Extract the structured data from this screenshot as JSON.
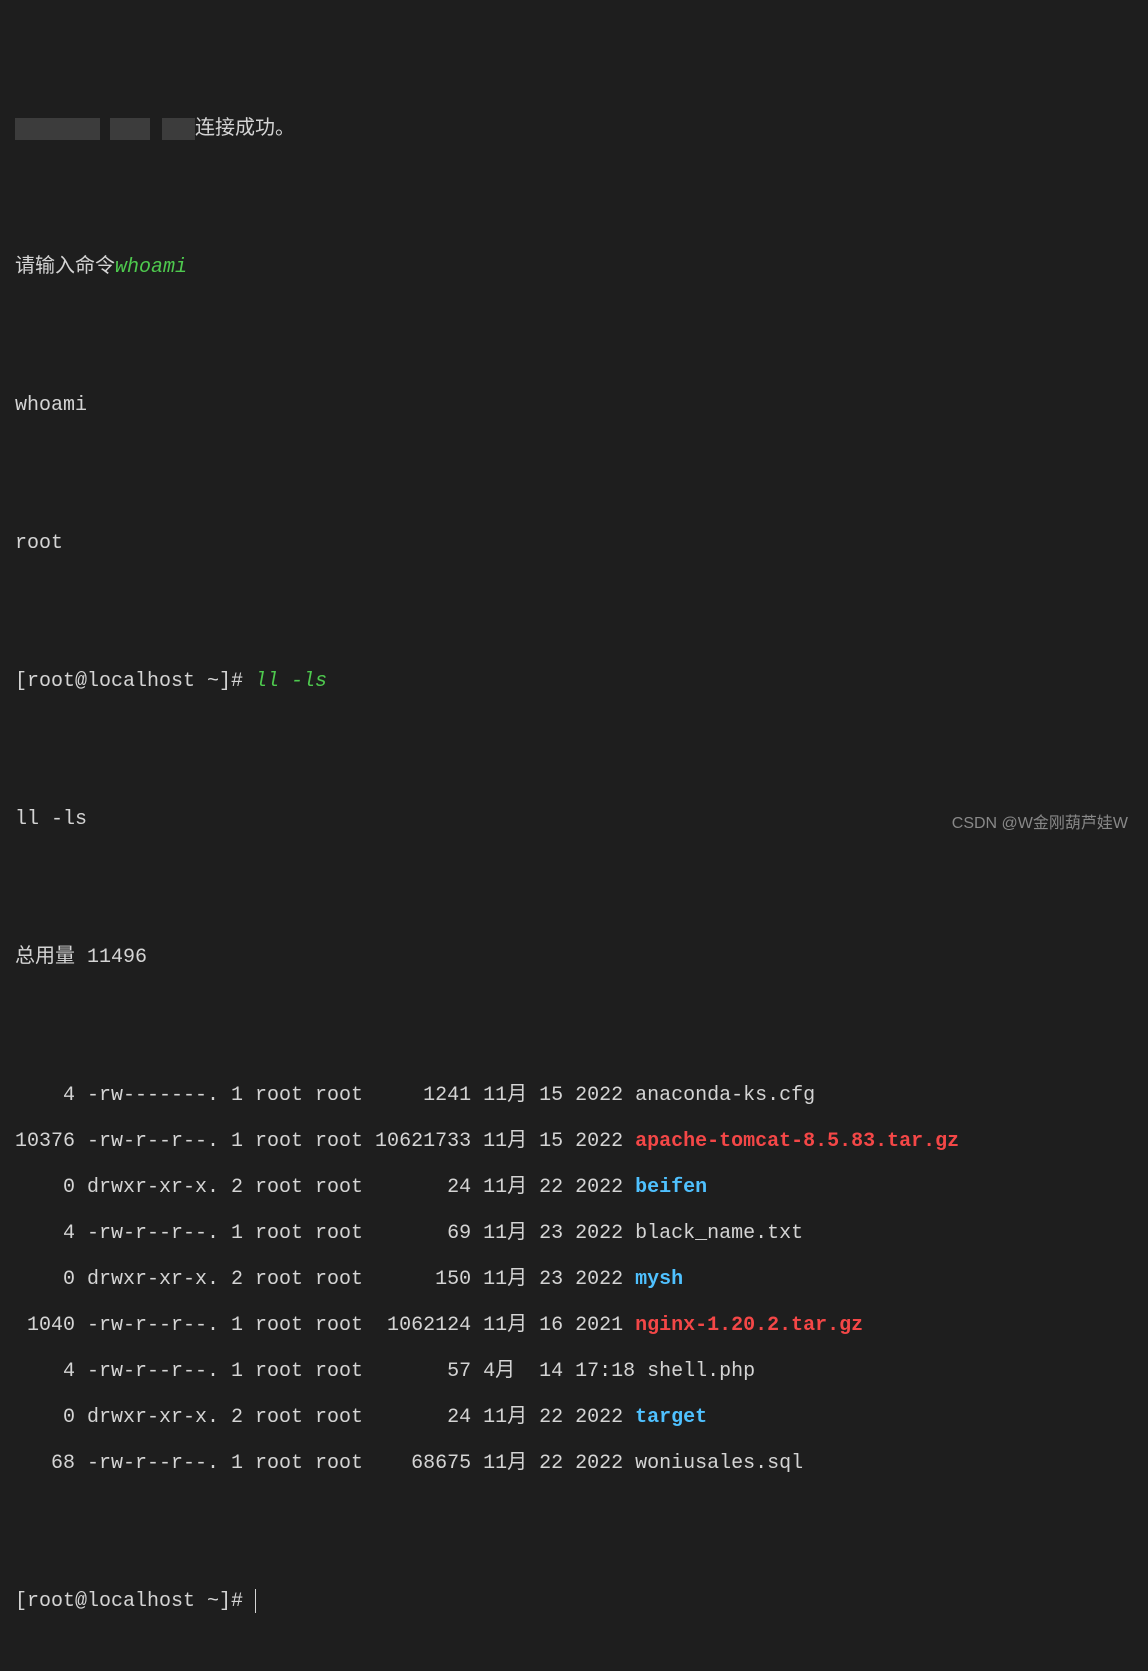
{
  "lines": {
    "l0_suffix": "连接成功。",
    "l1_prefix": "请输入命令",
    "l1_cmd": "whoami",
    "l2": "whoami",
    "l3": "root",
    "l4_prompt": "[root@localhost ~]# ",
    "l4_cmd": "ll -ls",
    "l5": "ll -ls",
    "l6": "总用量 11496",
    "files": [
      {
        "pre": "    4 -rw-------. 1 root root     1241 11月 15 2022 ",
        "name": "anaconda-ks.cfg",
        "class": ""
      },
      {
        "pre": "10376 -rw-r--r--. 1 root root 10621733 11月 15 2022 ",
        "name": "apache-tomcat-8.5.83.tar.gz",
        "class": "red"
      },
      {
        "pre": "    0 drwxr-xr-x. 2 root root       24 11月 22 2022 ",
        "name": "beifen",
        "class": "blue"
      },
      {
        "pre": "    4 -rw-r--r--. 1 root root       69 11月 23 2022 ",
        "name": "black_name.txt",
        "class": ""
      },
      {
        "pre": "    0 drwxr-xr-x. 2 root root      150 11月 23 2022 ",
        "name": "mysh",
        "class": "blue"
      },
      {
        "pre": " 1040 -rw-r--r--. 1 root root  1062124 11月 16 2021 ",
        "name": "nginx-1.20.2.tar.gz",
        "class": "red"
      },
      {
        "pre": "    4 -rw-r--r--. 1 root root       57 4月  14 17:18 ",
        "name": "shell.php",
        "class": ""
      },
      {
        "pre": "    0 drwxr-xr-x. 2 root root       24 11月 22 2022 ",
        "name": "target",
        "class": "blue"
      },
      {
        "pre": "   68 -rw-r--r--. 1 root root    68675 11月 22 2022 ",
        "name": "woniusales.sql",
        "class": ""
      }
    ],
    "last_prompt": "[root@localhost ~]# "
  },
  "watermark": "CSDN @W金刚葫芦娃W"
}
